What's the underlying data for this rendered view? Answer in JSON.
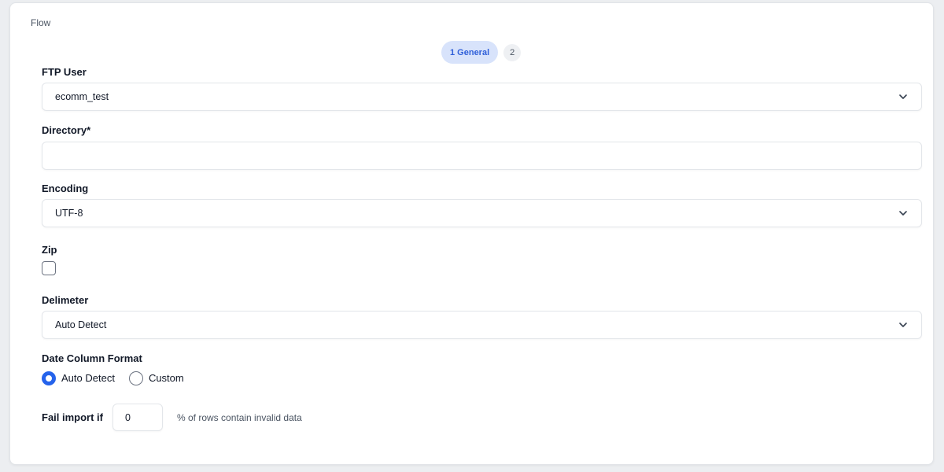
{
  "breadcrumb": "Flow",
  "steps": [
    {
      "label": "1 General"
    },
    {
      "label": "2"
    }
  ],
  "ftp_user": {
    "label": "FTP User",
    "value": "ecomm_test",
    "icon": "chevron-down-icon"
  },
  "directory": {
    "label": "Directory*",
    "value": ""
  },
  "encoding": {
    "label": "Encoding",
    "value": "UTF-8",
    "icon": "chevron-down-icon"
  },
  "zip": {
    "label": "Zip",
    "checked": false
  },
  "delimeter": {
    "label": "Delimeter",
    "value": "Auto Detect",
    "icon": "chevron-down-icon"
  },
  "date_column_format": {
    "label": "Date Column Format",
    "options": [
      {
        "label": "Auto Detect",
        "selected": true
      },
      {
        "label": "Custom",
        "selected": false
      }
    ]
  },
  "fail_import": {
    "label": "Fail import if",
    "value": "0",
    "suffix": "% of rows contain invalid data"
  },
  "colors": {
    "accent": "#2563eb",
    "active_step_bg": "#d8e3fb"
  }
}
